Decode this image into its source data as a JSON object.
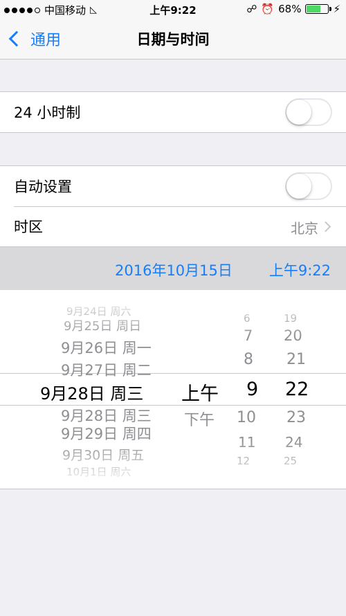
{
  "status_bar": {
    "carrier": "中国移动",
    "time": "上午9:22",
    "battery": "68%",
    "battery_level": 0.68,
    "wifi_icon": "wifi-icon",
    "lock_icon": "rotation-lock-icon",
    "alarm_icon": "alarm-icon",
    "charging_icon": "charging-bolt-icon"
  },
  "nav": {
    "back_label": "通用",
    "title": "日期与时间"
  },
  "settings": {
    "hour24_label": "24 小时制",
    "hour24_on": false,
    "auto_label": "自动设置",
    "auto_on": false,
    "timezone_label": "时区",
    "timezone_value": "北京"
  },
  "selected": {
    "date": "2016年10月15日",
    "time": "上午9:22"
  },
  "picker": {
    "dates": [
      "9月24日 周六",
      "9月25日 周日",
      "9月26日 周一",
      "9月27日 周二",
      "9月28日 周三",
      "9月28日 周三",
      "9月29日 周四",
      "9月30日 周五",
      "10月1日 周六"
    ],
    "ampm": [
      "上午",
      "下午"
    ],
    "hours": [
      "6",
      "7",
      "8",
      "9",
      "10",
      "11",
      "12"
    ],
    "minutes": [
      "19",
      "20",
      "21",
      "22",
      "23",
      "24",
      "25"
    ]
  },
  "colors": {
    "accent": "#157efb",
    "background": "#efeff4",
    "secondary_text": "#8e8e93"
  }
}
